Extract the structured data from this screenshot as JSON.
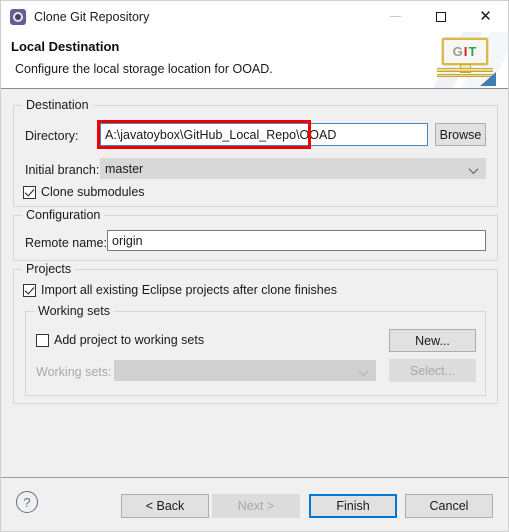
{
  "window": {
    "title": "Clone Git Repository",
    "icon": "gear-icon",
    "minimize_label": "—",
    "maximize_label": "□",
    "close_label": "✕"
  },
  "header": {
    "title": "Local Destination",
    "description": "Configure the local storage location for OOAD.",
    "logo_text": {
      "g": "G",
      "i": "I",
      "t": "T"
    }
  },
  "destination": {
    "group_label": "Destination",
    "directory_label": "Directory:",
    "directory_value": "A:\\javatoybox\\GitHub_Local_Repo\\OOAD",
    "browse_label": "Browse",
    "initial_branch_label": "Initial branch:",
    "initial_branch_value": "master",
    "clone_submodules_label": "Clone submodules",
    "clone_submodules_checked": true
  },
  "configuration": {
    "group_label": "Configuration",
    "remote_name_label": "Remote name:",
    "remote_name_value": "origin"
  },
  "projects": {
    "group_label": "Projects",
    "import_label": "Import all existing Eclipse projects after clone finishes",
    "import_checked": true,
    "working_sets": {
      "group_label": "Working sets",
      "add_label": "Add project to working sets",
      "add_checked": false,
      "new_button": "New...",
      "list_label": "Working sets:",
      "list_value": "",
      "select_button": "Select..."
    }
  },
  "footer": {
    "help_label": "?",
    "back_label": "< Back",
    "next_label": "Next >",
    "finish_label": "Finish",
    "cancel_label": "Cancel"
  },
  "colors": {
    "accent": "#0078d7",
    "focus_border": "#3c88c8",
    "annotation": "#ee0000",
    "dialog_bg": "#f0f0f0"
  }
}
